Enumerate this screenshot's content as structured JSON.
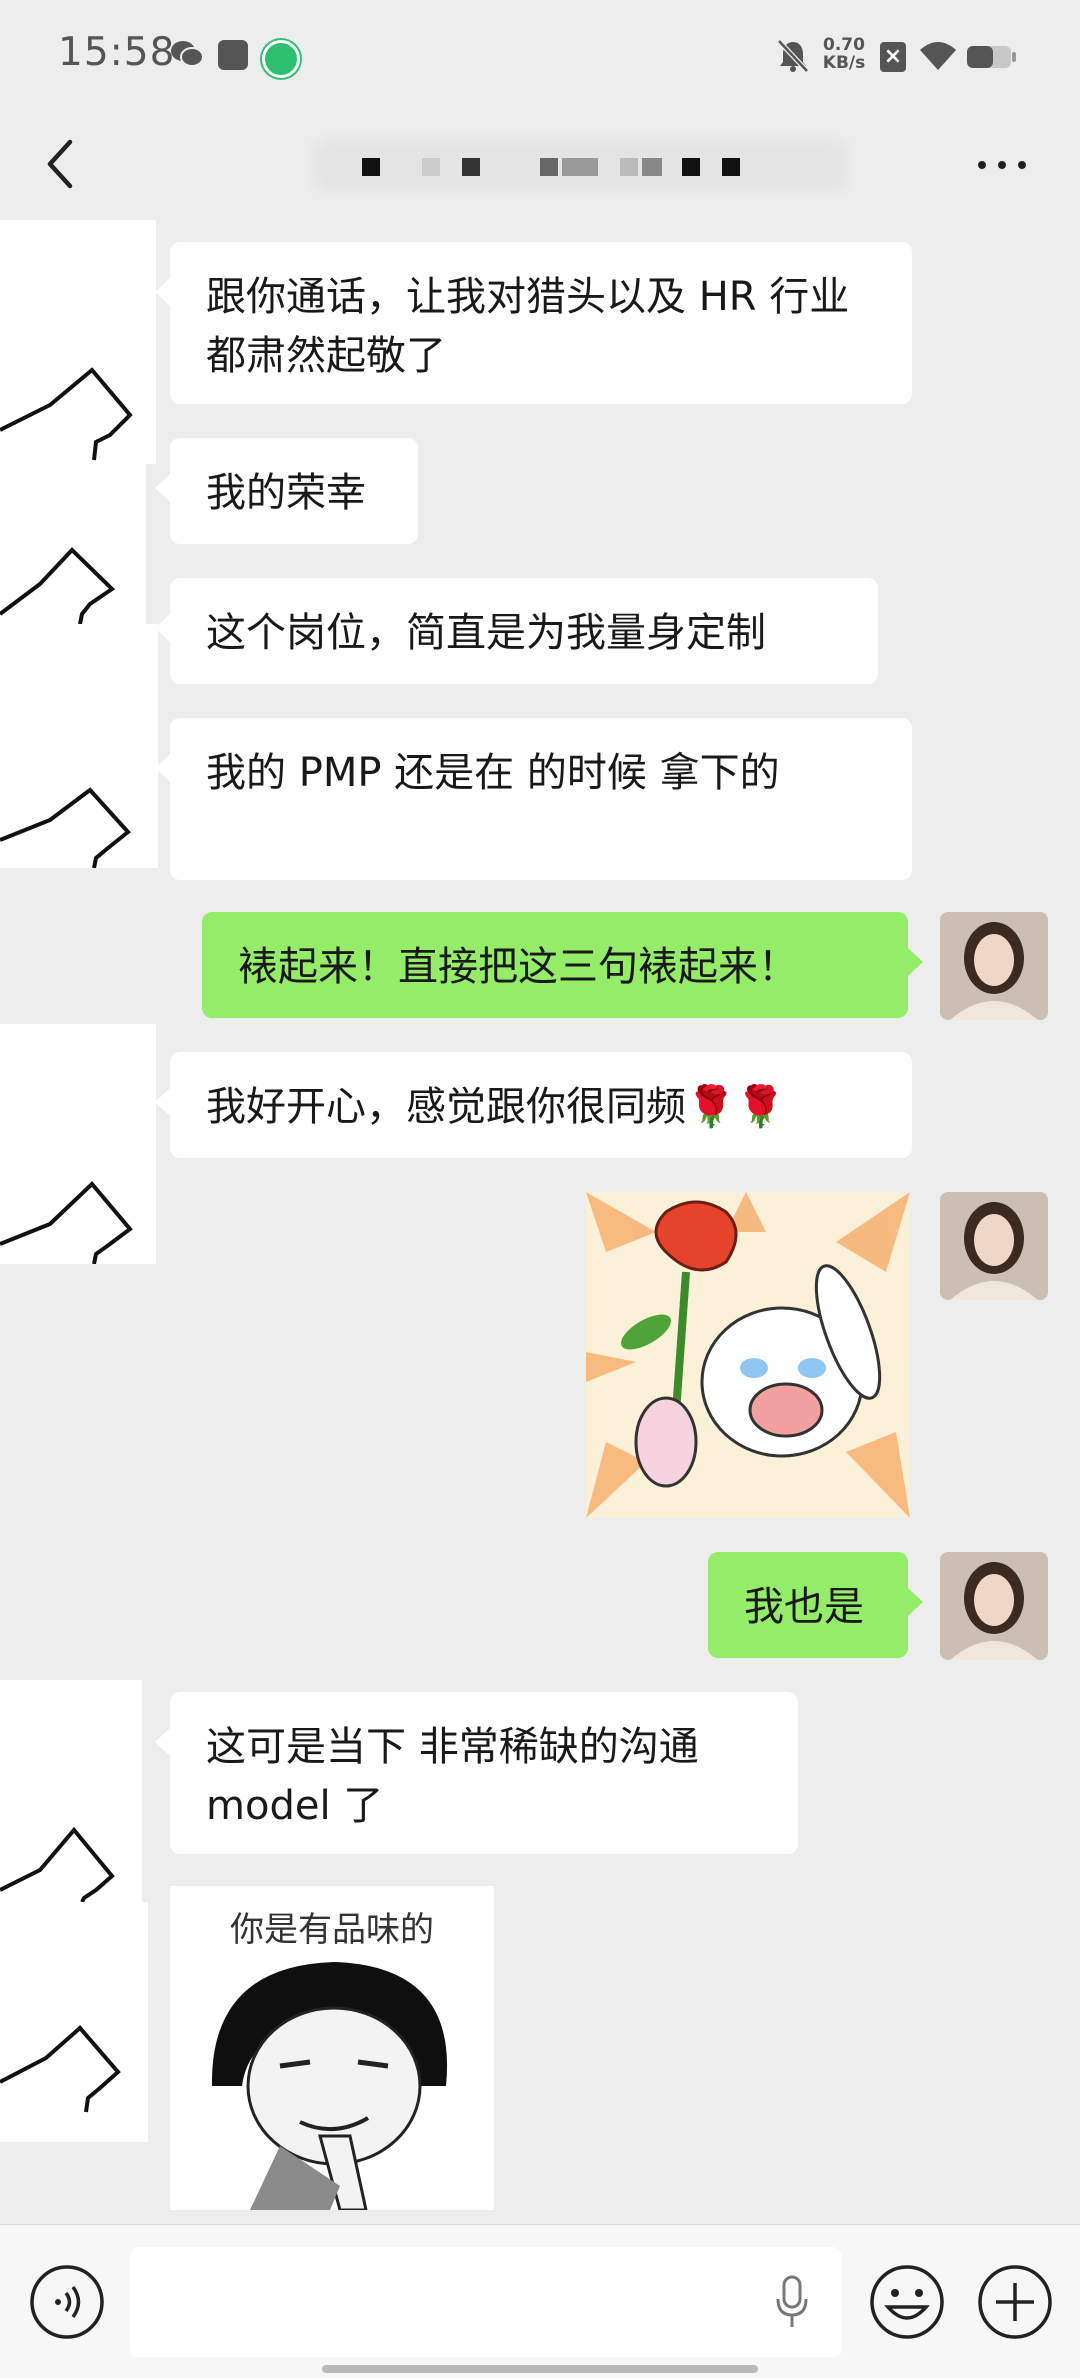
{
  "status_bar": {
    "time": "15:58",
    "net_speed_value": "0.70",
    "net_speed_unit": "KB/s",
    "icons": [
      "wechat-icon",
      "message-icon",
      "app-icon",
      "mute-icon",
      "close-icon",
      "wifi-icon",
      "battery-icon"
    ]
  },
  "header": {
    "title_obscured": true,
    "more_label": "···"
  },
  "messages": [
    {
      "from": "other",
      "text": "跟你通话，让我对猎头以及 HR 行业都肃然起敬了"
    },
    {
      "from": "other",
      "text": "我的荣幸"
    },
    {
      "from": "other",
      "text": "这个岗位，简直是为我量身定制"
    },
    {
      "from": "other",
      "text": "我的 PMP 还是在   的时候 拿下的"
    },
    {
      "from": "me",
      "text": "裱起来！直接把这三句裱起来！"
    },
    {
      "from": "other",
      "text": "我好开心，感觉跟你很同频🌹🌹"
    },
    {
      "from": "me",
      "type": "sticker",
      "sticker": "crying-bunny-with-rose"
    },
    {
      "from": "me",
      "text": "我也是"
    },
    {
      "from": "other",
      "text": "这可是当下 非常稀缺的沟通 model 了"
    },
    {
      "from": "other",
      "type": "sticker",
      "sticker": "meme-face",
      "caption": "你是有品味的"
    }
  ],
  "input_bar": {
    "placeholder": "",
    "icons": [
      "voice-icon",
      "microphone-icon",
      "emoji-icon",
      "plus-icon"
    ]
  },
  "colors": {
    "background": "#ededed",
    "outgoing_bubble": "#95ec69",
    "incoming_bubble": "#ffffff"
  }
}
